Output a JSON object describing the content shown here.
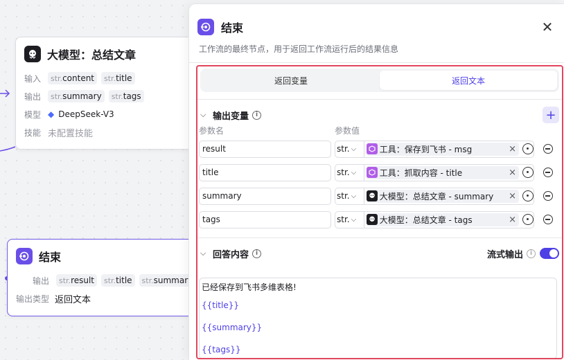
{
  "canvas": {
    "llm_node": {
      "title": "大模型：总结文章",
      "rows": [
        {
          "label": "输入",
          "tags": [
            {
              "t": "str.",
              "v": "content"
            },
            {
              "t": "str.",
              "v": "title"
            }
          ]
        },
        {
          "label": "输出",
          "tags": [
            {
              "t": "str.",
              "v": "summary"
            },
            {
              "t": "str.",
              "v": "tags"
            }
          ]
        }
      ],
      "model_label": "模型",
      "model_value": "DeepSeek-V3",
      "skill_label": "技能",
      "skill_value": "未配置技能"
    },
    "end_node": {
      "title": "结束",
      "output_label": "输出",
      "outputs": [
        {
          "t": "str.",
          "v": "result"
        },
        {
          "t": "str.",
          "v": "title"
        },
        {
          "t": "str.",
          "v": "summary"
        }
      ],
      "type_label": "输出类型",
      "type_value": "返回文本"
    }
  },
  "panel": {
    "title": "结束",
    "description": "工作流的最终节点，用于返回工作流运行后的结果信息",
    "tabs": [
      "返回变量",
      "返回文本"
    ],
    "active_tab": "返回文本",
    "output_vars": {
      "title": "输出变量",
      "col_name": "参数名",
      "col_value": "参数值",
      "rows": [
        {
          "name": "result",
          "type": "str.",
          "source": "工具：保存到飞书 - msg",
          "source_icon": "tool-icon"
        },
        {
          "name": "title",
          "type": "str.",
          "source": "工具：抓取内容 - title",
          "source_icon": "tool-icon"
        },
        {
          "name": "summary",
          "type": "str.",
          "source": "大模型：总结文章 - summary",
          "source_icon": "llm-icon"
        },
        {
          "name": "tags",
          "type": "str.",
          "source": "大模型：总结文章 - tags",
          "source_icon": "llm-icon"
        }
      ]
    },
    "answer": {
      "title": "回答内容",
      "stream_label": "流式输出",
      "stream_on": true,
      "lines": [
        "已经保存到飞书多维表格!",
        "{{title}}",
        "{{summary}}",
        "{{tags}}"
      ]
    }
  },
  "colors": {
    "accent": "#4e40e5",
    "highlight_box": "#e2455d",
    "tool_icon": "#b05ee8"
  }
}
